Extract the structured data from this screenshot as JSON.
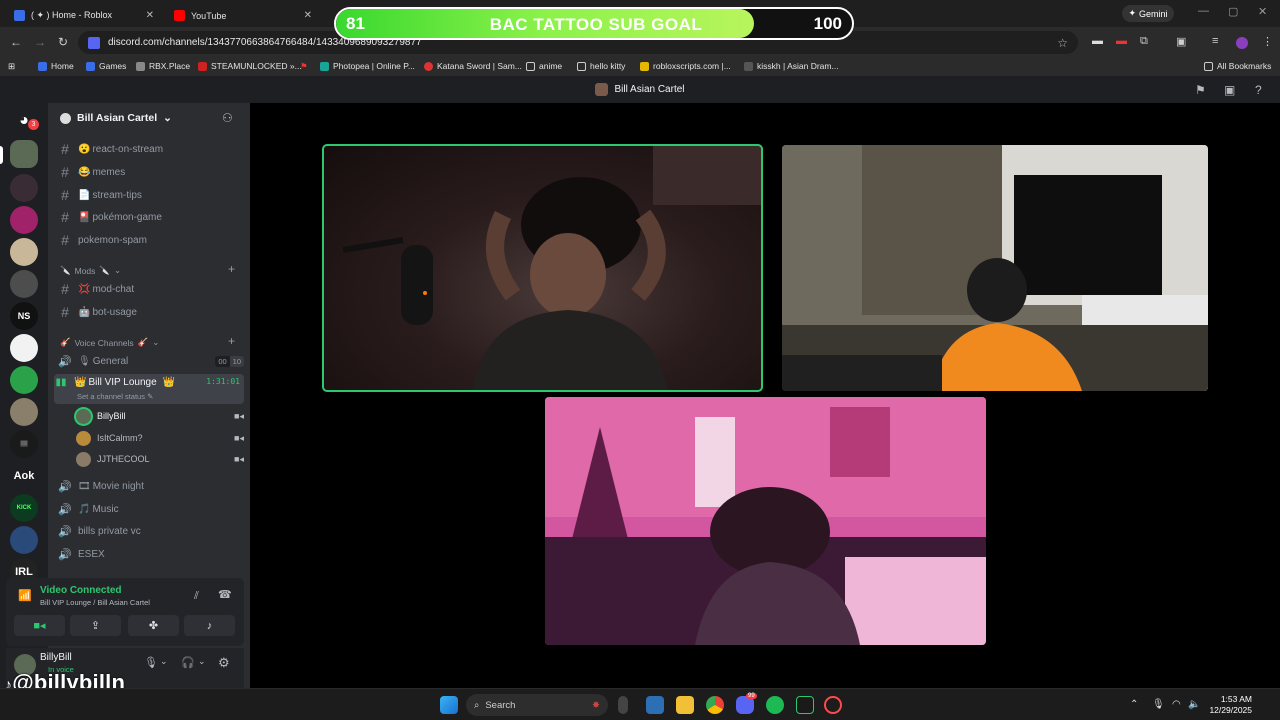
{
  "browser": {
    "tabs": [
      {
        "label": "( ✦ ) Home - Roblox"
      },
      {
        "label": "YouTube"
      }
    ],
    "url": "discord.com/channels/1343770663864766484/1433409689093279877",
    "gemini_label": "Gemini",
    "bookmarks": [
      "Home",
      "Games",
      "RBX.Place",
      "STEAMUNLOCKED »...",
      "Photopea | Online P...",
      "Katana Sword | Sam...",
      "anime",
      "hello kitty",
      "robloxscripts.com |...",
      "kisskh | Asian Dram..."
    ],
    "all_bookmarks": "All Bookmarks"
  },
  "goal_overlay": {
    "current": "81",
    "title": "BAC TATTOO SUB GOAL",
    "target": "100",
    "progress": 0.81
  },
  "discord": {
    "header_title": "Bill Asian Cartel",
    "server_name": "Bill Asian Cartel",
    "rail_badge": "3",
    "rail_labels": [
      "NS",
      "Aok",
      "IRL"
    ],
    "text_channels": [
      {
        "emoji": "😮",
        "name": "react-on-stream"
      },
      {
        "emoji": "😂",
        "name": "memes"
      },
      {
        "emoji": "📄",
        "name": "stream-tips"
      },
      {
        "emoji": "🎴",
        "name": "pokémon-game"
      },
      {
        "emoji": "",
        "name": "pokemon-spam"
      }
    ],
    "mods_category": "Mods",
    "mods_channels": [
      {
        "emoji": "💢",
        "name": "mod-chat"
      },
      {
        "emoji": "🤖",
        "name": "bot-usage"
      }
    ],
    "voice_category": "Voice Channels",
    "voice_general": {
      "name": "General",
      "count_a": "00",
      "count_b": "10"
    },
    "vip_lounge": {
      "name": "Bill VIP Lounge",
      "timer": "1:31:01",
      "status": "Set a channel status"
    },
    "members": [
      "BillyBill",
      "IsItCalmm?",
      "JJTHECOOL"
    ],
    "other_voice": [
      "Movie night",
      "Music",
      "bills private vc",
      "ESEX"
    ],
    "voice_panel": {
      "status": "Video Connected",
      "location": "Bill VIP Lounge / Bill Asian Cartel"
    },
    "user": {
      "name": "BillyBill",
      "status": "In voice"
    }
  },
  "watermark": "@billybilln",
  "taskbar": {
    "search": "Search",
    "time": "1:53 AM",
    "date": "12/29/2025",
    "discord_badge": "99"
  }
}
